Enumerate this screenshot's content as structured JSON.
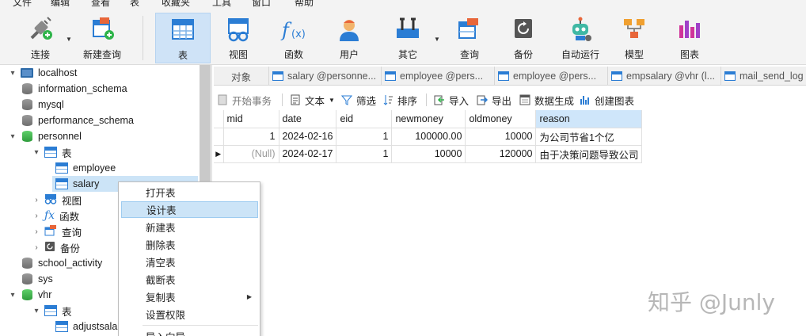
{
  "menu": [
    "文件",
    "编辑",
    "查看",
    "表",
    "收藏夹",
    "工具",
    "窗口",
    "帮助"
  ],
  "toolbar": {
    "buttons": [
      {
        "label": "连接",
        "icon": "plug-icon"
      },
      {
        "label": "新建查询",
        "icon": "new-query-icon"
      },
      {
        "label": "表",
        "icon": "table-icon"
      },
      {
        "label": "视图",
        "icon": "view-icon"
      },
      {
        "label": "函数",
        "icon": "function-icon"
      },
      {
        "label": "用户",
        "icon": "user-icon"
      },
      {
        "label": "其它",
        "icon": "tools-icon"
      },
      {
        "label": "查询",
        "icon": "query-icon"
      },
      {
        "label": "备份",
        "icon": "backup-icon"
      },
      {
        "label": "自动运行",
        "icon": "robot-icon"
      },
      {
        "label": "模型",
        "icon": "model-icon"
      },
      {
        "label": "图表",
        "icon": "chart-icon"
      }
    ],
    "active": "表"
  },
  "tree": {
    "nodes": [
      {
        "label": "localhost"
      },
      {
        "label": "information_schema"
      },
      {
        "label": "mysql"
      },
      {
        "label": "performance_schema"
      },
      {
        "label": "personnel"
      },
      {
        "label": "表"
      },
      {
        "label": "employee"
      },
      {
        "label": "salary"
      },
      {
        "label": "视图"
      },
      {
        "label": "函数"
      },
      {
        "label": "查询"
      },
      {
        "label": "备份"
      },
      {
        "label": "school_activity"
      },
      {
        "label": "sys"
      },
      {
        "label": "vhr"
      },
      {
        "label": "表"
      },
      {
        "label": "adjustsala"
      }
    ]
  },
  "tabs": [
    {
      "label": "对象"
    },
    {
      "label": "salary @personne..."
    },
    {
      "label": "employee @pers..."
    },
    {
      "label": "employee @pers..."
    },
    {
      "label": "empsalary @vhr (l..."
    },
    {
      "label": "mail_send_log"
    }
  ],
  "subtoolbar": [
    {
      "label": "开始事务"
    },
    {
      "label": "文本"
    },
    {
      "label": "筛选"
    },
    {
      "label": "排序"
    },
    {
      "label": "导入"
    },
    {
      "label": "导出"
    },
    {
      "label": "数据生成"
    },
    {
      "label": "创建图表"
    }
  ],
  "grid": {
    "columns": [
      "mid",
      "date",
      "eid",
      "newmoney",
      "oldmoney",
      "reason"
    ],
    "rows": [
      [
        "1",
        "2024-02-16",
        "1",
        "100000.00",
        "10000",
        "为公司节省1个亿"
      ],
      [
        "(Null)",
        "2024-02-17",
        "1",
        "10000",
        "120000",
        "由于决策问题导致公司"
      ]
    ]
  },
  "context_menu": {
    "items": [
      {
        "label": "打开表"
      },
      {
        "label": "设计表"
      },
      {
        "label": "新建表"
      },
      {
        "label": "删除表"
      },
      {
        "label": "清空表"
      },
      {
        "label": "截断表"
      },
      {
        "label": "复制表"
      },
      {
        "label": "设置权限"
      },
      {
        "label": "导入向导"
      }
    ],
    "highlighted": "设计表"
  },
  "watermark": "知乎 @Junly",
  "colors": {
    "accent": "#2b7dd4",
    "selection": "#cce4f7",
    "db_active": "#2f9c3c"
  }
}
